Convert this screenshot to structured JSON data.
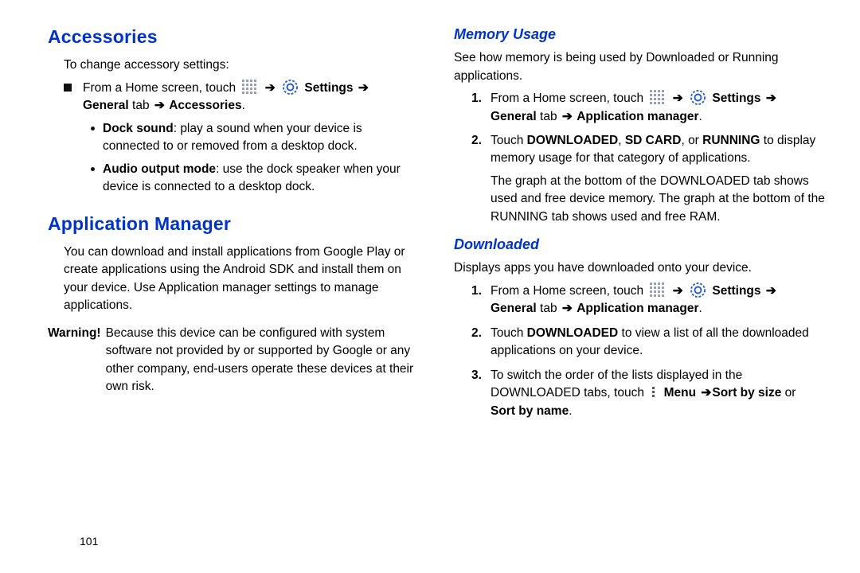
{
  "page_number": "101",
  "left": {
    "accessories": {
      "heading": "Accessories",
      "intro": "To change accessory settings:",
      "step_pre": "From a Home screen, touch",
      "step_post1": "Settings",
      "step_post2": "General",
      "step_post2_suffix": " tab ",
      "step_post3": "Accessories",
      "bullet1_bold": "Dock sound",
      "bullet1_rest": ": play a sound when your device is connected to or removed from a desktop dock.",
      "bullet2_bold": "Audio output mode",
      "bullet2_rest": ": use the dock speaker when your device is connected to a desktop dock."
    },
    "appmgr": {
      "heading": "Application Manager",
      "intro": "You can download and install applications from Google Play or create applications using the Android SDK and install them on your device. Use Application manager settings to manage applications.",
      "warning_label": "Warning!",
      "warning_text": "Because this device can be configured with system software not provided by or supported by Google or any other company, end-users operate these devices at their own risk."
    }
  },
  "right": {
    "memory": {
      "heading": "Memory Usage",
      "intro": "See how memory is being used by Downloaded or Running applications.",
      "s1_pre": "From a Home screen, touch",
      "s1_settings": "Settings",
      "s1_general": "General",
      "s1_general_suffix": " tab ",
      "s1_appmgr": "Application manager",
      "s2_a": "Touch ",
      "s2_dl": "DOWNLOADED",
      "s2_sep1": ", ",
      "s2_sd": "SD CARD",
      "s2_sep2": ", or ",
      "s2_run": "RUNNING",
      "s2_b": " to display memory usage for that category of applications.",
      "s2_graph": "The graph at the bottom of the DOWNLOADED tab shows used and free device memory. The graph at the bottom of the RUNNING tab shows used and free RAM."
    },
    "downloaded": {
      "heading": "Downloaded",
      "intro": "Displays apps you have downloaded onto your device.",
      "s1_pre": "From a Home screen, touch",
      "s1_settings": "Settings",
      "s1_general": "General",
      "s1_general_suffix": " tab ",
      "s1_appmgr": "Application manager",
      "s2_a": "Touch ",
      "s2_dl": "DOWNLOADED",
      "s2_b": " to view a list of all the downloaded applications on your device.",
      "s3_a": "To switch the order of the lists displayed in the DOWNLOADED tabs, touch ",
      "s3_menu": "Menu ",
      "s3_sort_size": "Sort by size",
      "s3_or": "  or ",
      "s3_sort_name": "Sort by name",
      "s3_end": "."
    }
  }
}
